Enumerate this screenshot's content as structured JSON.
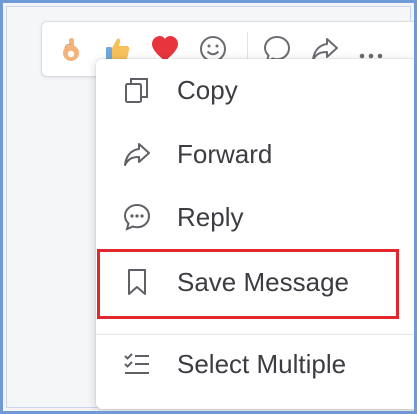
{
  "reactions": [
    {
      "name": "ok-hand-emoji",
      "color": "#f4b37a"
    },
    {
      "name": "thumbs-up-emoji",
      "color": "#f7c15a"
    },
    {
      "name": "heart-emoji",
      "color": "#e8343d"
    },
    {
      "name": "smiley-face-icon",
      "color": "#6b6c72"
    }
  ],
  "toolbar_actions": [
    {
      "name": "reply-bubble-icon"
    },
    {
      "name": "forward-icon"
    },
    {
      "name": "more-icon"
    }
  ],
  "menu": {
    "items": [
      {
        "id": "copy",
        "label": "Copy",
        "icon": "copy-icon"
      },
      {
        "id": "forward",
        "label": "Forward",
        "icon": "forward-icon"
      },
      {
        "id": "reply",
        "label": "Reply",
        "icon": "reply-icon"
      },
      {
        "id": "save",
        "label": "Save Message",
        "icon": "bookmark-icon"
      },
      {
        "id": "select",
        "label": "Select Multiple",
        "icon": "checklist-icon"
      }
    ]
  },
  "colors": {
    "frame_border": "#6f9ad6",
    "highlight_border": "#e3262c",
    "menu_text": "#3c3d42",
    "icon_stroke": "#5f6066"
  }
}
